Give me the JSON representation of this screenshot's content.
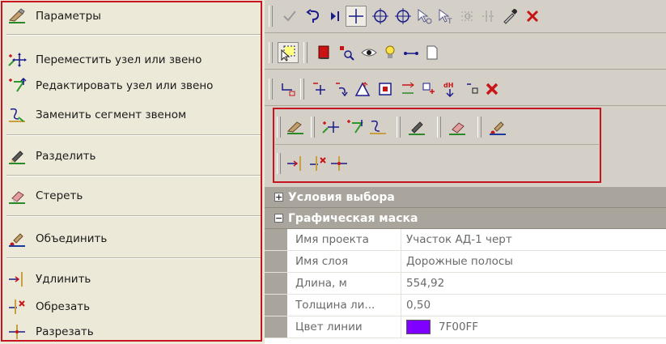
{
  "menu": {
    "items": [
      {
        "label": "Параметры",
        "icon": "pen-gear-icon"
      },
      {
        "label": "Переместить узел или звено",
        "icon": "move-node-icon"
      },
      {
        "label": "Редактировать узел или звено",
        "icon": "edit-node-icon"
      },
      {
        "label": "Заменить сегмент звеном",
        "icon": "replace-segment-icon"
      },
      {
        "label": "Разделить",
        "icon": "split-pen-icon"
      },
      {
        "label": "Стереть",
        "icon": "eraser-icon"
      },
      {
        "label": "Объединить",
        "icon": "merge-pen-icon"
      },
      {
        "label": "Удлинить",
        "icon": "extend-icon"
      },
      {
        "label": "Обрезать",
        "icon": "trim-icon"
      },
      {
        "label": "Разрезать",
        "icon": "cut-icon"
      }
    ]
  },
  "properties": {
    "categories": [
      {
        "label": "Условия выбора",
        "expander": "+"
      },
      {
        "label": "Графическая маска",
        "expander": "−"
      }
    ],
    "rows": [
      {
        "name": "Имя проекта",
        "value": "Участок АД-1 черт"
      },
      {
        "name": "Имя слоя",
        "value": "Дорожные полосы"
      },
      {
        "name": "Длина, м",
        "value": "554,92"
      },
      {
        "name": "Толщина ли...",
        "value": "0,50"
      },
      {
        "name": "Цвет линии",
        "value": "7F00FF"
      }
    ]
  },
  "colors": {
    "highlight_frame": "#c8141e",
    "line_color_swatch": "#7f00ff",
    "menu_bg": "#ece9d8",
    "toolbar_bg": "#d4d0c8",
    "category_bg": "#a9a59c"
  }
}
